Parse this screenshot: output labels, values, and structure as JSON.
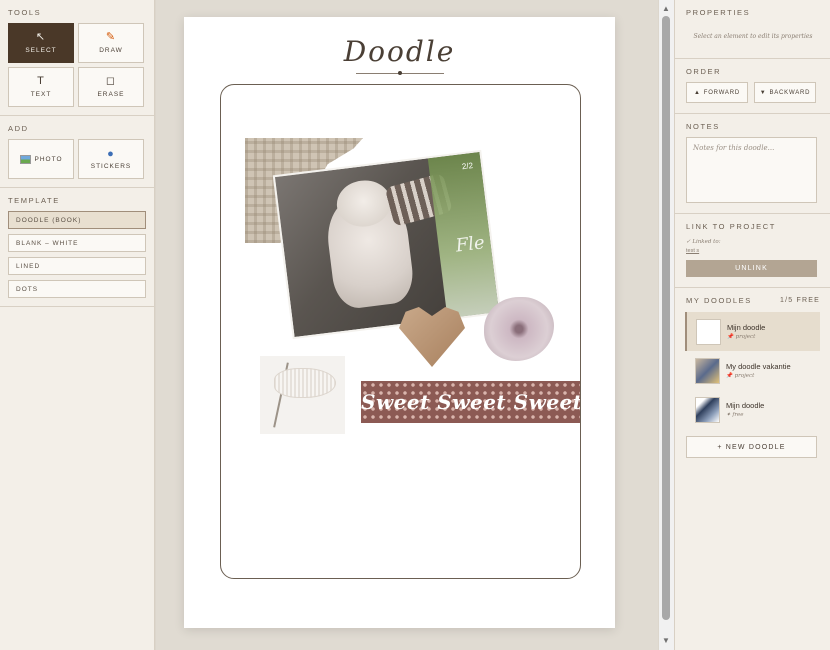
{
  "tools": {
    "title": "TOOLS",
    "select": "SELECT",
    "draw": "DRAW",
    "text": "TEXT",
    "erase": "ERASE"
  },
  "add": {
    "title": "ADD",
    "photo": "PHOTO",
    "stickers": "STICKERS"
  },
  "template": {
    "title": "TEMPLATE",
    "items": [
      "DOODLE (BOOK)",
      "BLANK – WHITE",
      "LINED",
      "DOTS"
    ]
  },
  "canvas": {
    "title": "Doodle",
    "photo_label": "2/2",
    "photo_glass": "Fle",
    "tape_text": "Sweet Sweet Sweet"
  },
  "properties": {
    "title": "PROPERTIES",
    "hint": "Select an element to edit its properties"
  },
  "order": {
    "title": "ORDER",
    "forward": "FORWARD",
    "backward": "BACKWARD"
  },
  "notes": {
    "title": "NOTES",
    "placeholder": "Notes for this doodle..."
  },
  "link": {
    "title": "LINK TO PROJECT",
    "linked": "✓ Linked to:",
    "linked_sub": "test s",
    "unlink": "UNLINK"
  },
  "my_doodles": {
    "title": "MY DOODLES",
    "free": "1/5 FREE",
    "items": [
      {
        "name": "Mijn doodle",
        "sub": "project"
      },
      {
        "name": "My doodle vakantie",
        "sub": "project"
      },
      {
        "name": "Mijn doodle",
        "sub": "free"
      }
    ],
    "new": "+ NEW DOODLE"
  },
  "colors": {
    "accent_dark": "#4a3828",
    "panel_bg": "#f3efe8",
    "unlink_bg": "#b3a593"
  }
}
